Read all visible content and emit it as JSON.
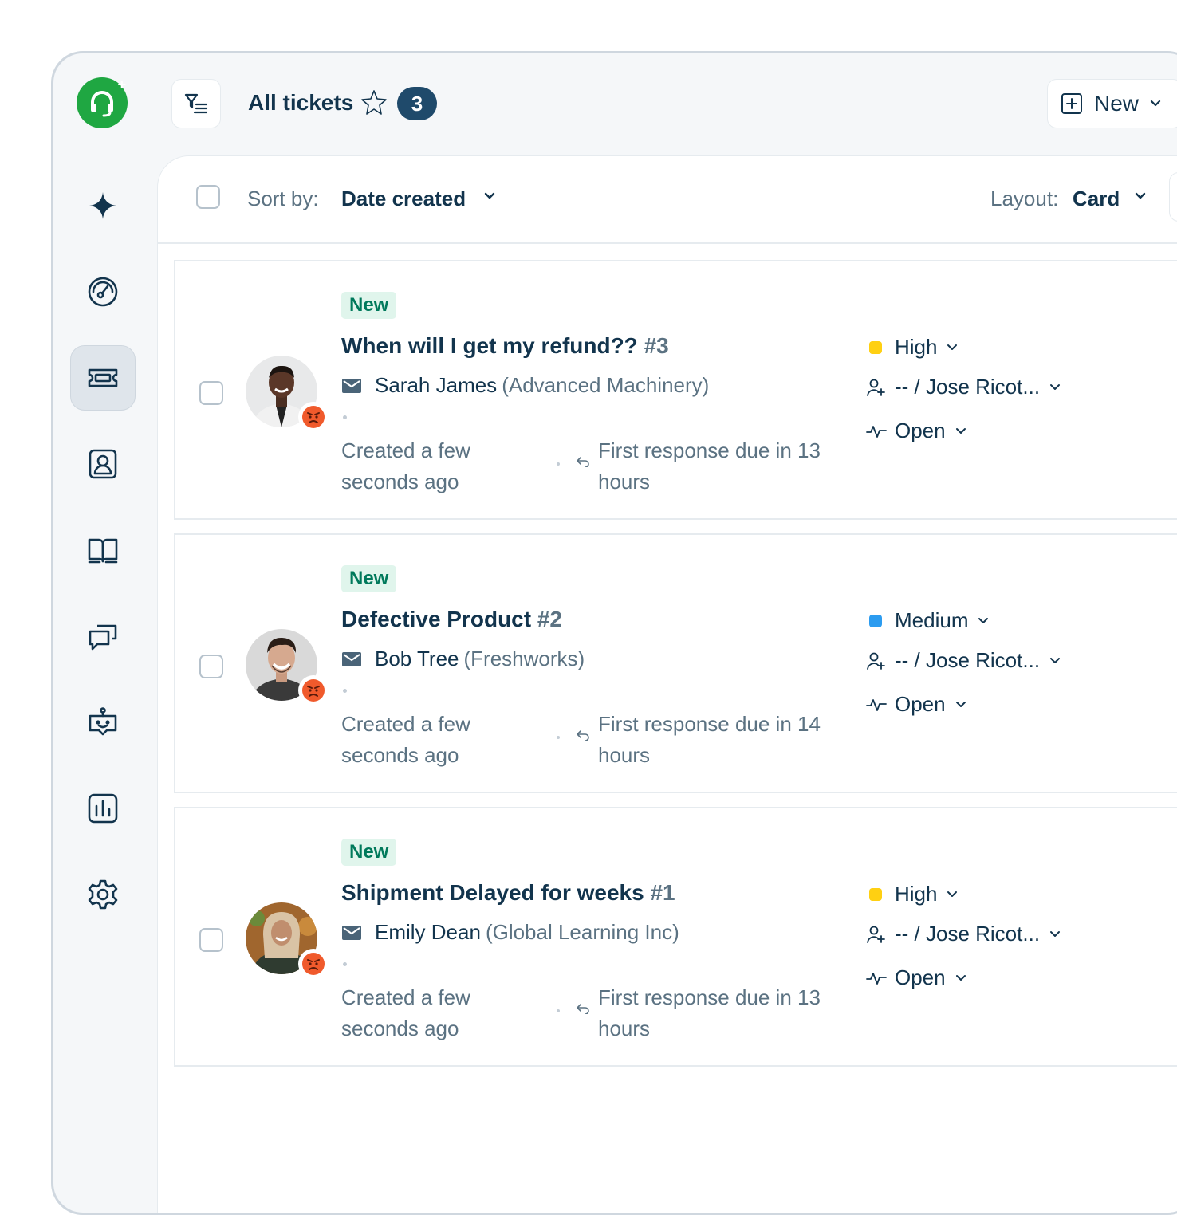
{
  "header": {
    "title": "All tickets",
    "count": "3",
    "new_button": "New"
  },
  "toolbar": {
    "sort_label": "Sort by:",
    "sort_value": "Date created",
    "layout_label": "Layout:",
    "layout_value": "Card"
  },
  "sidebar": {
    "items": [
      "freddy-ai-icon",
      "dashboard-icon",
      "tickets-icon",
      "contacts-icon",
      "knowledge-base-icon",
      "conversations-icon",
      "bot-icon",
      "reports-icon",
      "settings-icon"
    ],
    "active": "tickets-icon"
  },
  "colors": {
    "brand_green": "#1fa742",
    "priority_high": "#ffd012",
    "priority_medium": "#2c9cf0",
    "tag_bg": "#e0f5ec",
    "tag_text": "#00795b"
  },
  "tickets": [
    {
      "status_tag": "New",
      "subject": "When will I get my refund??",
      "number": "#3",
      "requester": "Sarah James",
      "company": "(Advanced Machinery)",
      "created": "Created a few seconds ago",
      "due": "First response due in 13 hours",
      "priority": "High",
      "assignee": "-- / Jose Ricot...",
      "status": "Open"
    },
    {
      "status_tag": "New",
      "subject": "Defective Product",
      "number": "#2",
      "requester": "Bob Tree",
      "company": "(Freshworks)",
      "created": "Created a few seconds ago",
      "due": "First response due in 14 hours",
      "priority": "Medium",
      "assignee": "-- / Jose Ricot...",
      "status": "Open"
    },
    {
      "status_tag": "New",
      "subject": "Shipment Delayed for weeks",
      "number": "#1",
      "requester": "Emily Dean",
      "company": "(Global Learning Inc)",
      "created": "Created a few seconds ago",
      "due": "First response due in 13 hours",
      "priority": "High",
      "assignee": "-- / Jose Ricot...",
      "status": "Open"
    }
  ]
}
